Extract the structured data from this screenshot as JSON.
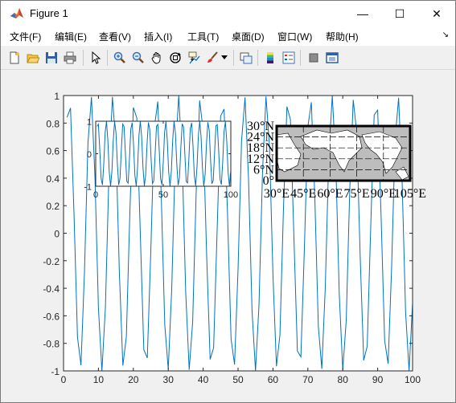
{
  "window": {
    "title": "Figure 1",
    "minimize_glyph": "—",
    "maximize_glyph": "☐",
    "close_glyph": "✕"
  },
  "menubar": {
    "items": [
      {
        "label": "文件(F)"
      },
      {
        "label": "编辑(E)"
      },
      {
        "label": "查看(V)"
      },
      {
        "label": "插入(I)"
      },
      {
        "label": "工具(T)"
      },
      {
        "label": "桌面(D)"
      },
      {
        "label": "窗口(W)"
      },
      {
        "label": "帮助(H)"
      }
    ],
    "overflow_glyph": "↘"
  },
  "toolbar": {
    "icons": [
      "new-figure-icon",
      "open-icon",
      "save-icon",
      "print-icon",
      "edit-plot-arrow-icon",
      "zoom-in-icon",
      "zoom-out-icon",
      "pan-hand-icon",
      "rotate-3d-icon",
      "data-cursor-icon",
      "brush-icon",
      "dropdown-arrow-icon",
      "link-plot-icon",
      "colorbar-icon",
      "legend-icon",
      "hide-plot-tools-icon",
      "show-plot-tools-icon"
    ]
  },
  "colors": {
    "line": "#0072bd",
    "axes_bg": "#ffffff",
    "figure_bg": "#f0f0f0",
    "land": "#bdbdbd"
  },
  "chart_data": [
    {
      "type": "line",
      "role": "main",
      "xlim": [
        0,
        100
      ],
      "ylim": [
        -1,
        1
      ],
      "xticks": [
        "0",
        "10",
        "20",
        "30",
        "40",
        "50",
        "60",
        "70",
        "80",
        "90",
        "100"
      ],
      "yticks": [
        "1",
        "0.8",
        "0.6",
        "0.4",
        "0.2",
        "0",
        "-0.2",
        "-0.4",
        "-0.6",
        "-0.8",
        "-1"
      ],
      "series": [
        {
          "function": "sin",
          "x_start": 1,
          "x_end": 100,
          "x_step": 1
        }
      ]
    },
    {
      "type": "line",
      "role": "inset",
      "xlim": [
        0,
        100
      ],
      "ylim": [
        -1,
        1
      ],
      "xticks": [
        "0",
        "50",
        "100"
      ],
      "yticks": [
        "1",
        "0",
        "-1"
      ],
      "series": [
        {
          "function": "sin",
          "x_start": 1,
          "x_end": 100,
          "x_step": 1
        }
      ]
    },
    {
      "type": "map",
      "role": "inset-map",
      "lat_labels": [
        "30°N",
        "24°N",
        "18°N",
        "12°N",
        "6°N",
        "0°"
      ],
      "lon_labels": [
        "30°E",
        "45°E",
        "60°E",
        "75°E",
        "90°E",
        "105°E"
      ]
    }
  ]
}
